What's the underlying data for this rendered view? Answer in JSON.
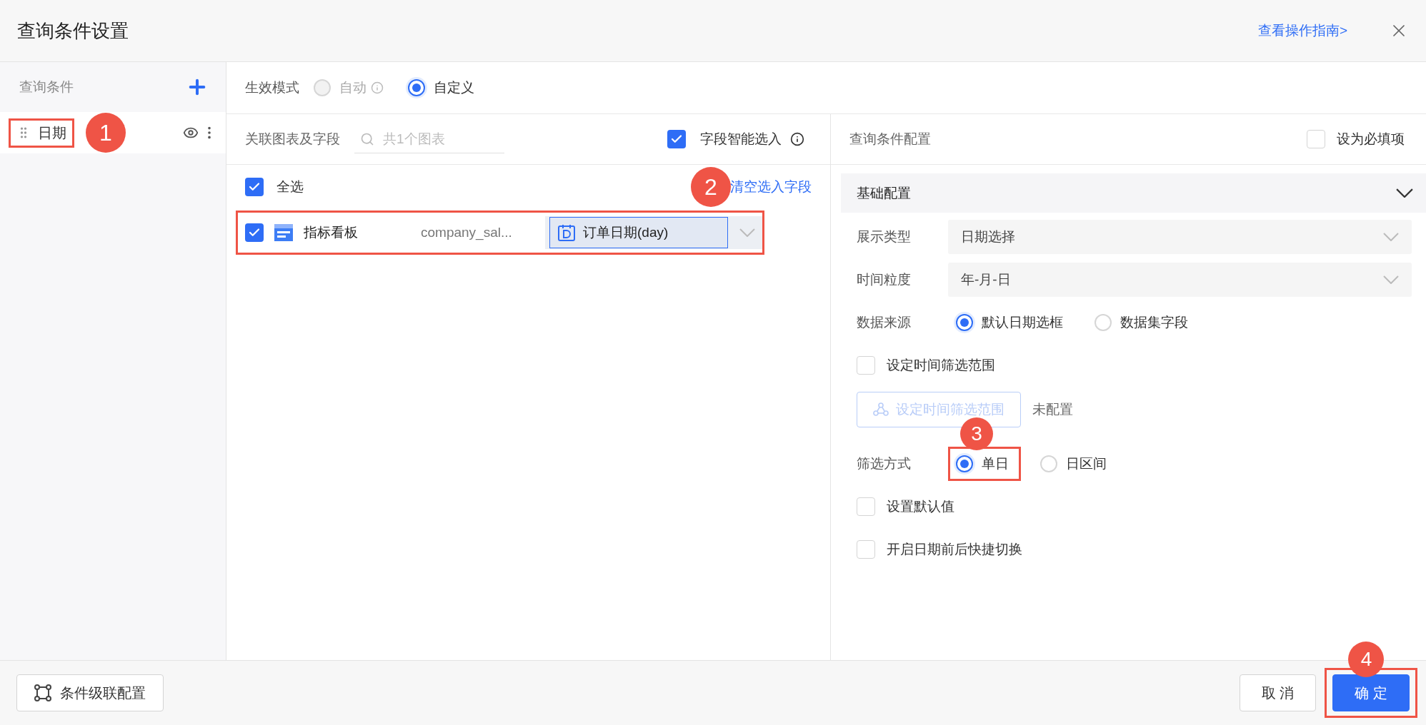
{
  "dialog": {
    "title": "查询条件设置",
    "guide_link": "查看操作指南>"
  },
  "sidebar": {
    "title": "查询条件",
    "items": [
      {
        "label": "日期",
        "selected": true,
        "highlighted": true,
        "badge": "1"
      }
    ]
  },
  "mode": {
    "label": "生效模式",
    "options": [
      {
        "label": "自动",
        "selected": false,
        "disabled": true
      },
      {
        "label": "自定义",
        "selected": true,
        "disabled": false
      }
    ]
  },
  "linked": {
    "label": "关联图表及字段",
    "search_placeholder": "共1个图表",
    "smart": {
      "label": "字段智能选入",
      "checked": true
    },
    "select_all": {
      "label": "全选",
      "checked": true
    },
    "clear_link": "清空选入字段",
    "badge": "2",
    "rows": [
      {
        "checked": true,
        "highlighted": true,
        "chart": "指标看板",
        "dataset": "company_sal...",
        "field": "订单日期(day)"
      }
    ]
  },
  "config": {
    "title": "查询条件配置",
    "required": {
      "label": "设为必填项",
      "checked": false
    },
    "section": {
      "title": "基础配置",
      "expanded": true
    },
    "fields": [
      {
        "kind": "select",
        "label": "展示类型",
        "value": "日期选择"
      },
      {
        "kind": "select",
        "label": "时间粒度",
        "value": "年-月-日"
      },
      {
        "kind": "radio",
        "label": "数据来源",
        "options": [
          {
            "label": "默认日期选框",
            "selected": true,
            "highlighted": false
          },
          {
            "label": "数据集字段",
            "selected": false,
            "highlighted": false
          }
        ]
      },
      {
        "kind": "checkbox",
        "label": "设定时间筛选范围",
        "checked": false
      },
      {
        "kind": "button",
        "label": "设定时间筛选范围",
        "disabled": true,
        "note": "未配置"
      },
      {
        "kind": "radio",
        "label": "筛选方式",
        "options": [
          {
            "label": "单日",
            "selected": true,
            "highlighted": true,
            "badge": "3"
          },
          {
            "label": "日区间",
            "selected": false,
            "highlighted": false
          }
        ]
      },
      {
        "kind": "checkbox",
        "label": "设置默认值",
        "checked": false
      },
      {
        "kind": "checkbox",
        "label": "开启日期前后快捷切换",
        "checked": false
      }
    ]
  },
  "footer": {
    "cascade_button": "条件级联配置",
    "cancel_button": "取 消",
    "confirm_button": {
      "label": "确 定",
      "highlighted": true,
      "badge": "4"
    }
  }
}
